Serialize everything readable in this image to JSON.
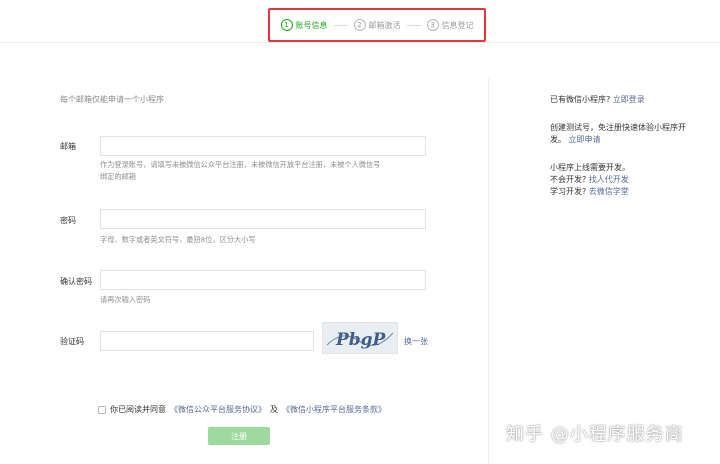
{
  "steps": [
    {
      "num": "1",
      "label": "账号信息",
      "active": true
    },
    {
      "num": "2",
      "label": "邮箱激活",
      "active": false
    },
    {
      "num": "3",
      "label": "信息登记",
      "active": false
    }
  ],
  "form": {
    "notice": "每个邮箱仅能申请一个小程序",
    "email": {
      "label": "邮箱",
      "value": "",
      "hint_line1": "作为登录账号，请填写未被微信公众平台注册，未被微信开放平台注册，未被个人微信号",
      "hint_line2": "绑定的邮箱"
    },
    "password": {
      "label": "密码",
      "value": "",
      "hint": "字母、数字或者英文符号，最短8位，区分大小写"
    },
    "confirm_password": {
      "label": "确认密码",
      "value": "",
      "hint": "请再次输入密码"
    },
    "captcha": {
      "label": "验证码",
      "value": "",
      "image_text": "PbgP",
      "refresh_label": "换一张"
    },
    "agreement": {
      "checked": false,
      "prefix": "你已阅读并同意",
      "link1": "《微信公众平台服务协议》",
      "connector": "及",
      "link2": "《微信小程序平台服务条款》"
    },
    "register_label": "注册"
  },
  "sidebar": {
    "login_prompt": "已有微信小程序?",
    "login_link": "立即登录",
    "test_prompt_line1": "创建测试号，免注册快速体验小程序开",
    "test_prompt_line2": "发。",
    "test_link": "立即申请",
    "dev_prompt": "小程序上线需要开发。",
    "no_dev_prompt": "不会开发?",
    "no_dev_link": "找人代开发",
    "learn_prompt": "学习开发?",
    "learn_link": "去微信学堂"
  },
  "watermark": "知乎 @小程序服务商",
  "colors": {
    "accent_green": "#1aad19",
    "highlight_red": "#e0383e",
    "link_blue": "#576b95",
    "button_disabled": "#9ed99d"
  }
}
